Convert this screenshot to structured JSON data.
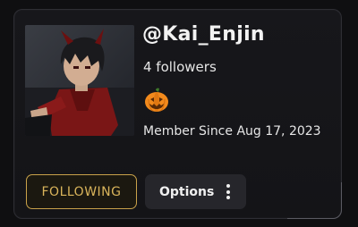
{
  "profile": {
    "username": "@Kai_Enjin",
    "followers_text": "4 followers",
    "badge_icon": "jack-o-lantern-icon",
    "member_since_text": "Member Since Aug 17, 2023"
  },
  "actions": {
    "following_label": "FOLLOWING",
    "options_label": "Options",
    "options_icon": "vertical-ellipsis-icon"
  },
  "colors": {
    "accent_gold": "#c9a24a",
    "card_background": "#17171b",
    "button_background": "#26262b"
  }
}
